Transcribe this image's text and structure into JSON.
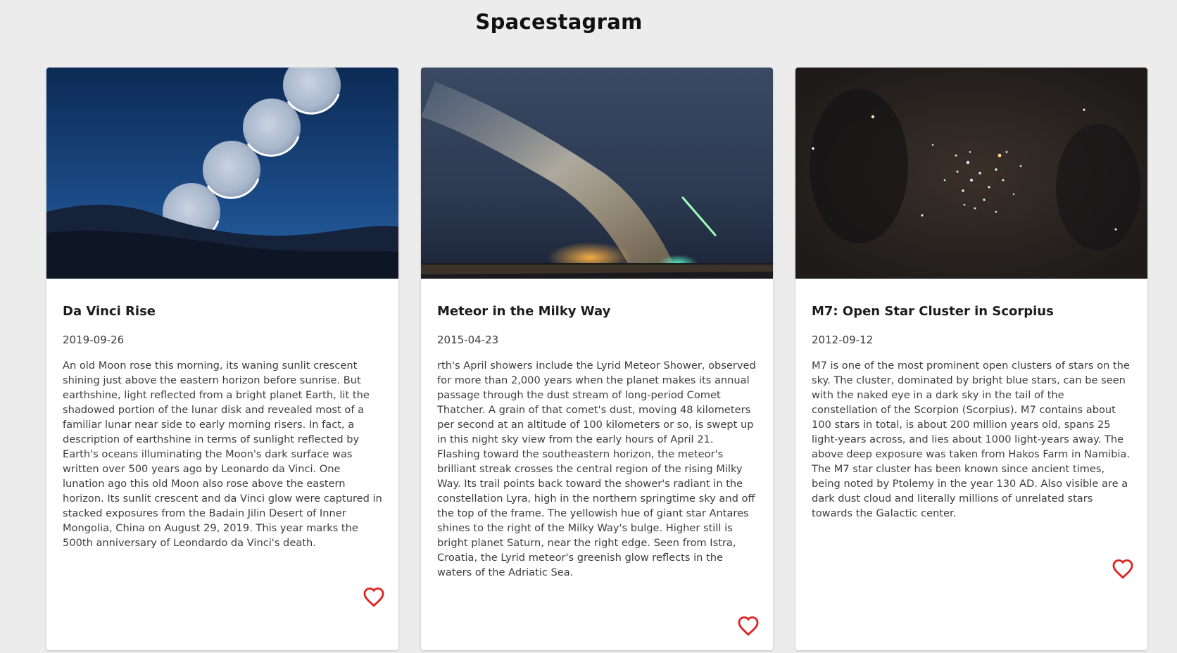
{
  "page": {
    "title": "Spacestagram"
  },
  "colors": {
    "background": "#ececec",
    "card": "#ffffff",
    "heart": "#e0201e"
  },
  "posts": [
    {
      "title": "Da Vinci Rise",
      "date": "2019-09-26",
      "description": "An old Moon rose this morning, its waning sunlit crescent shining just above the eastern horizon before sunrise. But earthshine, light reflected from a bright planet Earth, lit the shadowed portion of the lunar disk and revealed most of a familiar lunar near side to early morning risers. In fact, a description of earthshine in terms of sunlight reflected by Earth's oceans illuminating the Moon's dark surface was written over 500 years ago by Leonardo da Vinci. One lunation ago this old Moon also rose above the eastern horizon. Its sunlit crescent and da Vinci glow were captured in stacked exposures from the Badain Jilin Desert of Inner Mongolia, China on August 29, 2019. This year marks the 500th anniversary of Leondardo da Vinci's death.",
      "liked": false,
      "like_icon": "heart-outline-icon"
    },
    {
      "title": "Meteor in the Milky Way",
      "date": "2015-04-23",
      "description": "rth's April showers include the Lyrid Meteor Shower, observed for more than 2,000 years when the planet makes its annual passage through the dust stream of long-period Comet Thatcher. A grain of that comet's dust, moving 48 kilometers per second at an altitude of 100 kilometers or so, is swept up in this night sky view from the early hours of April 21. Flashing toward the southeastern horizon, the meteor's brilliant streak crosses the central region of the rising Milky Way. Its trail points back toward the shower's radiant in the constellation Lyra, high in the northern springtime sky and off the top of the frame. The yellowish hue of giant star Antares shines to the right of the Milky Way's bulge. Higher still is bright planet Saturn, near the right edge. Seen from Istra, Croatia, the Lyrid meteor's greenish glow reflects in the waters of the Adriatic Sea.",
      "liked": false,
      "like_icon": "heart-outline-icon"
    },
    {
      "title": "M7: Open Star Cluster in Scorpius",
      "date": "2012-09-12",
      "description": "M7 is one of the most prominent open clusters of stars on the sky. The cluster, dominated by bright blue stars, can be seen with the naked eye in a dark sky in the tail of the constellation of the Scorpion (Scorpius). M7 contains about 100 stars in total, is about 200 million years old, spans 25 light-years across, and lies about 1000 light-years away. The above deep exposure was taken from Hakos Farm in Namibia. The M7 star cluster has been known since ancient times, being noted by Ptolemy in the year 130 AD. Also visible are a dark dust cloud and literally millions of unrelated stars towards the Galactic center.",
      "liked": false,
      "like_icon": "heart-outline-icon"
    }
  ]
}
